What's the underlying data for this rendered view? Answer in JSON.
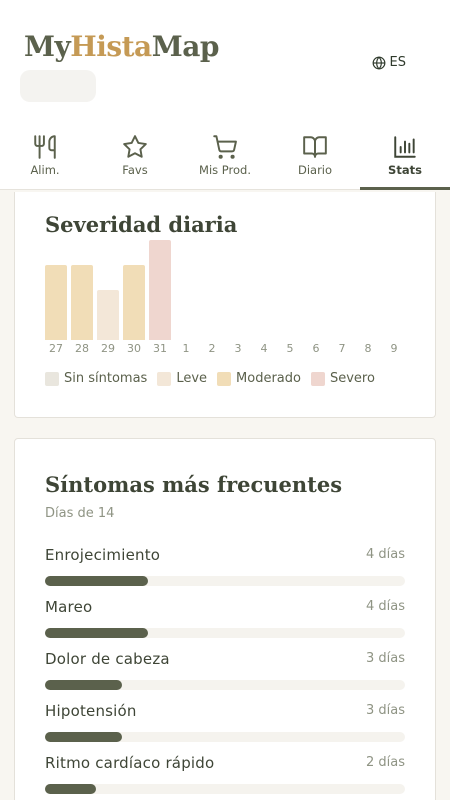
{
  "header": {
    "logo_part1": "My",
    "logo_part2": "Hista",
    "logo_part3": "Map",
    "language": "ES"
  },
  "tabs": [
    {
      "label": "Alim.",
      "icon": "fork-knife-icon",
      "active": false
    },
    {
      "label": "Favs",
      "icon": "star-icon",
      "active": false
    },
    {
      "label": "Mis Prod.",
      "icon": "cart-icon",
      "active": false
    },
    {
      "label": "Diario",
      "icon": "book-icon",
      "active": false
    },
    {
      "label": "Stats",
      "icon": "bar-chart-icon",
      "active": true
    }
  ],
  "severity": {
    "title": "Severidad diaria",
    "legend": [
      {
        "label": "Sin síntomas",
        "color": "#e9e6de"
      },
      {
        "label": "Leve",
        "color": "#f3e7d8"
      },
      {
        "label": "Moderado",
        "color": "#f1ddb7"
      },
      {
        "label": "Severo",
        "color": "#efd6cf"
      }
    ]
  },
  "chart_data": {
    "type": "bar",
    "title": "Severidad diaria",
    "categories": [
      "27",
      "28",
      "29",
      "30",
      "31",
      "1",
      "2",
      "3",
      "4",
      "5",
      "6",
      "7",
      "8",
      "9"
    ],
    "values": [
      3,
      3,
      2,
      3,
      4,
      null,
      null,
      null,
      null,
      null,
      null,
      null,
      null,
      null
    ],
    "bar_colors": [
      "#f1ddb7",
      "#f1ddb7",
      "#f3e7d8",
      "#f1ddb7",
      "#efd6cf",
      null,
      null,
      null,
      null,
      null,
      null,
      null,
      null,
      null
    ],
    "ylim": [
      0,
      4
    ],
    "grid": false,
    "legend_position": "bottom"
  },
  "symptoms": {
    "title": "Síntomas más frecuentes",
    "subtitle": "Días de 14",
    "total_days": 14,
    "items": [
      {
        "name": "Enrojecimiento",
        "days_label": "4 días",
        "days": 4
      },
      {
        "name": "Mareo",
        "days_label": "4 días",
        "days": 4
      },
      {
        "name": "Dolor de cabeza",
        "days_label": "3 días",
        "days": 3
      },
      {
        "name": "Hipotensión",
        "days_label": "3 días",
        "days": 3
      },
      {
        "name": "Ritmo cardíaco rápido",
        "days_label": "2 días",
        "days": 2
      }
    ]
  }
}
